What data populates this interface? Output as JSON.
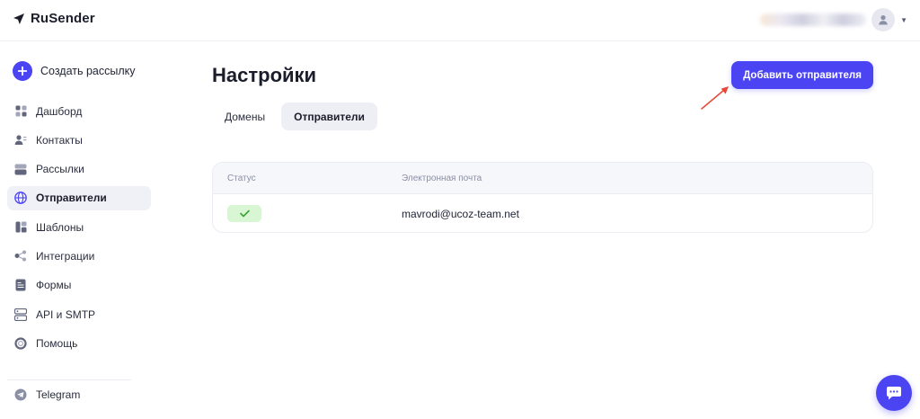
{
  "app": {
    "brand": "RuSender"
  },
  "header": {
    "user_menu_icon": "user-icon",
    "caret_icon": "caret-down-icon"
  },
  "sidebar": {
    "create_label": "Создать рассылку",
    "items": [
      {
        "label": "Дашборд",
        "icon": "dashboard-icon",
        "active": false
      },
      {
        "label": "Контакты",
        "icon": "contacts-icon",
        "active": false
      },
      {
        "label": "Рассылки",
        "icon": "mailings-icon",
        "active": false
      },
      {
        "label": "Отправители",
        "icon": "senders-icon",
        "active": true
      },
      {
        "label": "Шаблоны",
        "icon": "templates-icon",
        "active": false
      },
      {
        "label": "Интеграции",
        "icon": "integrations-icon",
        "active": false
      },
      {
        "label": "Формы",
        "icon": "forms-icon",
        "active": false
      },
      {
        "label": "API и SMTP",
        "icon": "api-icon",
        "active": false
      },
      {
        "label": "Помощь",
        "icon": "help-icon",
        "active": false
      }
    ],
    "telegram_label": "Telegram"
  },
  "main": {
    "title": "Настройки",
    "tabs": [
      {
        "label": "Домены",
        "active": false
      },
      {
        "label": "Отправители",
        "active": true
      }
    ],
    "add_button_label": "Добавить отправителя",
    "table": {
      "columns": [
        "Статус",
        "Электронная почта"
      ],
      "rows": [
        {
          "status": "verified",
          "status_icon": "check-icon",
          "email": "mavrodi@ucoz-team.net"
        }
      ]
    }
  },
  "colors": {
    "accent": "#4b44f2",
    "status_ok_bg": "#d8f5d4",
    "status_ok_fg": "#3aa336",
    "annotation_arrow": "#e8483a"
  }
}
